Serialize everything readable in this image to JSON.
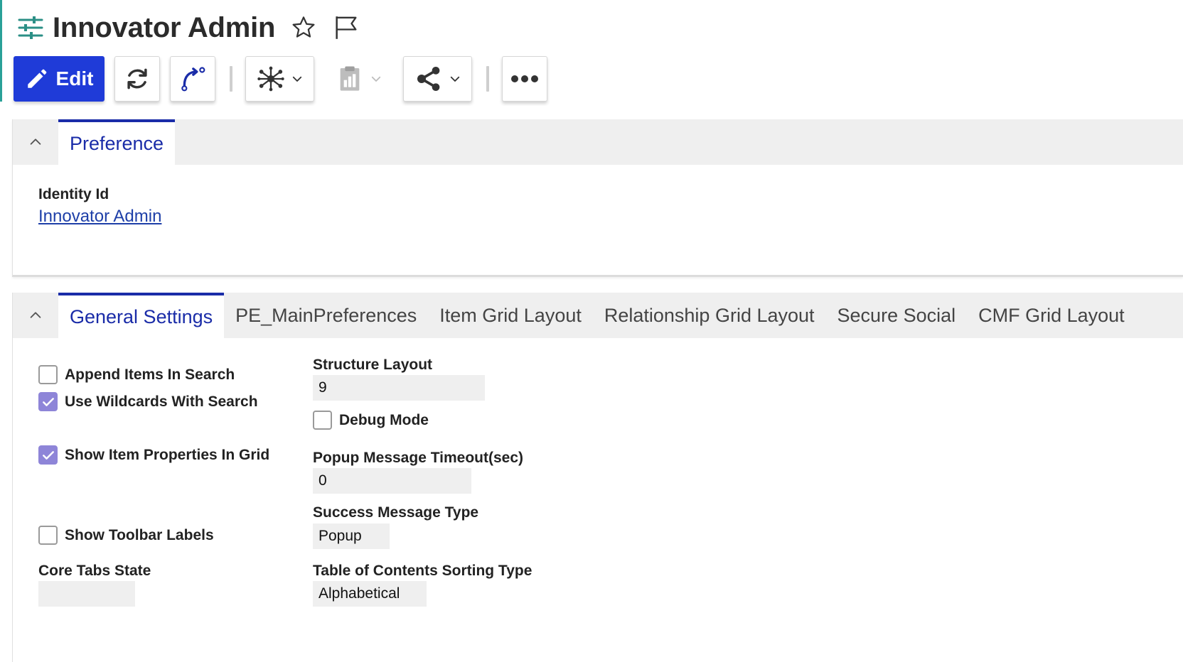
{
  "header": {
    "title": "Innovator Admin",
    "icons": [
      "sliders-icon",
      "star-icon",
      "flag-icon"
    ]
  },
  "toolbar": {
    "edit_label": "Edit",
    "edit_color": "#1f3bd8",
    "buttons": [
      "pencil-icon",
      "refresh-icon",
      "promote-icon",
      "network-icon",
      "clipboard-chart-icon",
      "share-icon",
      "more-icon"
    ]
  },
  "preference_panel": {
    "tab_label": "Preference",
    "identity_label": "Identity Id",
    "identity_value": "Innovator Admin"
  },
  "general_panel": {
    "tabs": [
      {
        "label": "General Settings",
        "active": true
      },
      {
        "label": "PE_MainPreferences"
      },
      {
        "label": "Item Grid Layout"
      },
      {
        "label": "Relationship Grid Layout"
      },
      {
        "label": "Secure Social"
      },
      {
        "label": "CMF Grid Layout"
      }
    ],
    "checkboxes": [
      {
        "label": "Append Items In Search",
        "checked": false
      },
      {
        "label": "Use Wildcards With Search",
        "checked": true
      },
      {
        "label": "Show Item Properties In Grid",
        "checked": true
      },
      {
        "label": "Show Toolbar Labels",
        "checked": false
      },
      {
        "label": "Debug Mode",
        "checked": false
      }
    ],
    "core_tabs_state_label": "Core Tabs State",
    "core_tabs_state_value": "",
    "structure_layout_label": "Structure Layout",
    "structure_layout_value": "9",
    "popup_timeout_label": "Popup Message Timeout(sec)",
    "popup_timeout_value": "0",
    "success_type_label": "Success Message Type",
    "success_type_value": "Popup",
    "toc_sorting_label": "Table of Contents Sorting Type",
    "toc_sorting_value": "Alphabetical"
  },
  "colors": {
    "accent": "#1a2ca8",
    "checkbox_checked": "#8e85d8",
    "left_accent": "#2aa198"
  }
}
